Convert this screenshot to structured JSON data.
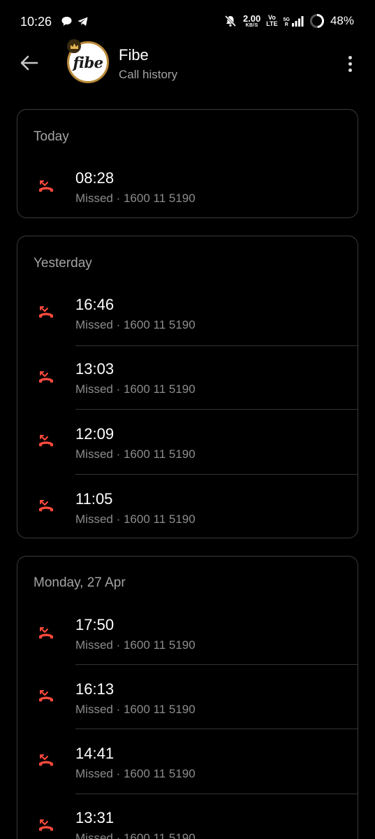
{
  "status_bar": {
    "time": "10:26",
    "speed_value": "2.00",
    "speed_unit": "KB/S",
    "volte_top": "Vo",
    "volte_bottom": "LTE",
    "network_type": "5G",
    "roaming": "R",
    "battery_percent": "48%",
    "battery_level": 0.48
  },
  "header": {
    "contact_name": "Fibe",
    "subtitle": "Call history",
    "avatar_logo_text": "fibe"
  },
  "colors": {
    "missed_red": "#ff4a3d",
    "avatar_ring": "#b98a3a"
  },
  "groups": [
    {
      "title": "Today",
      "calls": [
        {
          "time": "08:28",
          "status": "Missed",
          "number": "1600 11 5190",
          "icon": "missed-call-icon"
        }
      ]
    },
    {
      "title": "Yesterday",
      "calls": [
        {
          "time": "16:46",
          "status": "Missed",
          "number": "1600 11 5190",
          "icon": "missed-call-icon"
        },
        {
          "time": "13:03",
          "status": "Missed",
          "number": "1600 11 5190",
          "icon": "missed-call-icon"
        },
        {
          "time": "12:09",
          "status": "Missed",
          "number": "1600 11 5190",
          "icon": "missed-call-icon"
        },
        {
          "time": "11:05",
          "status": "Missed",
          "number": "1600 11 5190",
          "icon": "missed-call-icon"
        }
      ]
    },
    {
      "title": "Monday, 27 Apr",
      "calls": [
        {
          "time": "17:50",
          "status": "Missed",
          "number": "1600 11 5190",
          "icon": "missed-call-icon"
        },
        {
          "time": "16:13",
          "status": "Missed",
          "number": "1600 11 5190",
          "icon": "missed-call-icon"
        },
        {
          "time": "14:41",
          "status": "Missed",
          "number": "1600 11 5190",
          "icon": "missed-call-icon"
        },
        {
          "time": "13:31",
          "status": "Missed",
          "number": "1600 11 5190",
          "icon": "missed-call-icon"
        }
      ]
    }
  ]
}
